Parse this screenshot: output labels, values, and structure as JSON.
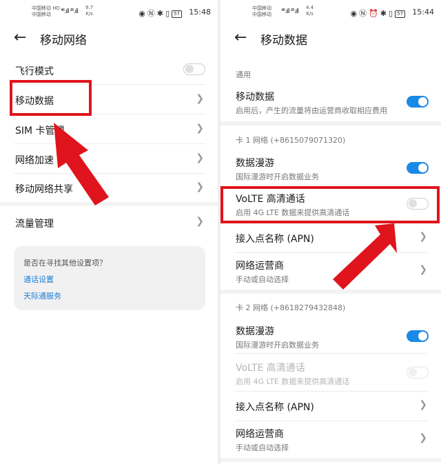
{
  "left": {
    "status": {
      "carrier_line1": "中国移动 HD",
      "carrier_line2": "中国移动",
      "signal": "⁴⁶.ıll ²⁶.ıll",
      "speed_value": "9.7",
      "speed_unit": "K/s",
      "battery": "57",
      "time": "15:48"
    },
    "title": "移动网络",
    "rows": [
      {
        "label": "飞行模式"
      },
      {
        "label": "移动数据"
      },
      {
        "label": "SIM 卡管理"
      },
      {
        "label": "网络加速"
      },
      {
        "label": "移动网络共享"
      },
      {
        "label": "流量管理"
      }
    ],
    "card": {
      "question": "是否在寻找其他设置项？",
      "links": [
        "通话设置",
        "天际通服务"
      ]
    }
  },
  "right": {
    "status": {
      "carrier_line1": "中国移动",
      "carrier_line2": "中国移动",
      "signal": "⁴⁶.ıll ²⁶.ıll",
      "speed_value": "4.4",
      "speed_unit": "K/s",
      "battery": "57",
      "time": "15:44"
    },
    "title": "移动数据",
    "general_header": "通用",
    "mobile_data": {
      "label": "移动数据",
      "sub": "启用后，产生的流量将由运营商收取相应费用",
      "on": true
    },
    "sim1_header": "卡 1 网络 (+8615079071320)",
    "sim1": {
      "roaming_label": "数据漫游",
      "roaming_sub": "国际漫游时开启数据业务",
      "roaming_on": true,
      "volte_label": "VoLTE 高清通话",
      "volte_sub": "启用 4G LTE 数据来提供高清通话",
      "volte_on": false,
      "apn_label": "接入点名称 (APN)",
      "operator_label": "网络运营商",
      "operator_sub": "手动或自动选择"
    },
    "sim2_header": "卡 2 网络 (+8618279432848)",
    "sim2": {
      "roaming_label": "数据漫游",
      "roaming_sub": "国际漫游时开启数据业务",
      "roaming_on": true,
      "volte_label": "VoLTE 高清通话",
      "volte_sub": "启用 4G LTE 数据来提供高清通话",
      "volte_on": false,
      "apn_label": "接入点名称 (APN)",
      "operator_label": "网络运营商",
      "operator_sub": "手动或自动选择"
    }
  },
  "icons": {
    "back": "back-arrow-icon",
    "chevron": "chevron-right-icon"
  },
  "colors": {
    "accent": "#1a8ae6",
    "annotation": "#e0141c",
    "link": "#1a7fd8"
  }
}
